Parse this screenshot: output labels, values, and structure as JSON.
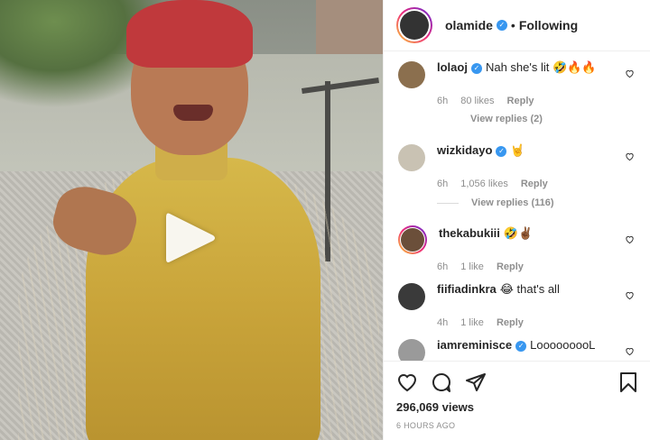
{
  "post": {
    "username": "olamide",
    "follow_status": "Following",
    "separator": "•",
    "views": "296,069 views",
    "time_ago": "6 HOURS AGO"
  },
  "comments": [
    {
      "username": "lolaoj",
      "verified": true,
      "text": "Nah she's lit 🤣🔥🔥",
      "time": "6h",
      "likes": "80 likes",
      "reply": "Reply",
      "view_replies": "View replies (2)"
    },
    {
      "username": "wizkidayo",
      "verified": true,
      "text": "🤘",
      "time": "6h",
      "likes": "1,056 likes",
      "reply": "Reply",
      "view_replies": "View replies (116)"
    },
    {
      "username": "thekabukiii",
      "verified": false,
      "text": "🤣✌🏾",
      "time": "6h",
      "likes": "1 like",
      "reply": "Reply"
    },
    {
      "username": "fiifiadinkra",
      "verified": false,
      "text": "😂 that's all",
      "time": "4h",
      "likes": "1 like",
      "reply": "Reply"
    },
    {
      "username": "iamreminisce",
      "verified": true,
      "text": "LooooooooL"
    }
  ],
  "colors": {
    "verified": "#3897f0",
    "secondary_text": "#8e8e8e",
    "primary_text": "#262626"
  },
  "icons": {
    "play": "play-icon",
    "like": "heart-icon",
    "comment": "comment-icon",
    "share": "share-icon",
    "save": "bookmark-icon"
  }
}
